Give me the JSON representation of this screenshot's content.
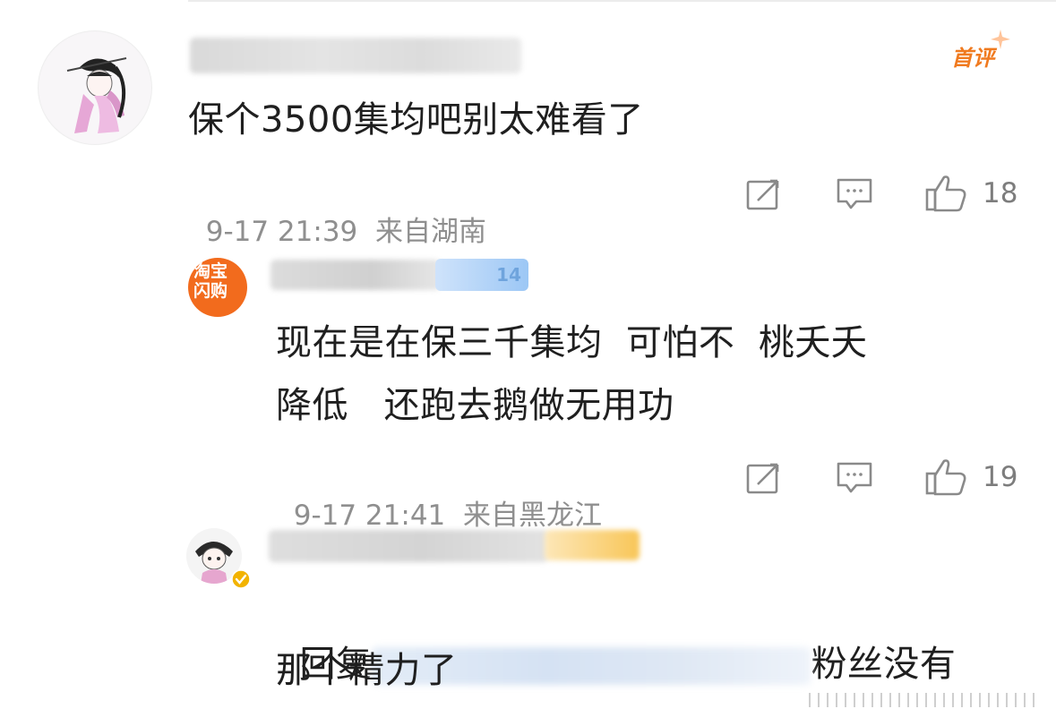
{
  "comment1": {
    "badge": "首评",
    "text": "保个3500集均吧别太难看了",
    "time": "9-17 21:39",
    "location": "来自湖南",
    "likes": "18"
  },
  "reply1": {
    "app_badge_line1": "淘宝",
    "app_badge_line2": "闪购",
    "name_badge_tail": "14",
    "text_line1": "现在是在保三千集均  可怕不  桃夭夭",
    "text_line2": "降低   还跑去鹅做无用功",
    "time": "9-17 21:41",
    "location": "来自黑龙江",
    "likes": "19"
  },
  "reply2": {
    "text_prefix": "回复",
    "text_suffix": "粉丝没有",
    "text_line2": "那个精力了"
  },
  "colors": {
    "accent": "#f07a1f",
    "meta": "#8f8f8f",
    "verified": "#f2b300"
  }
}
